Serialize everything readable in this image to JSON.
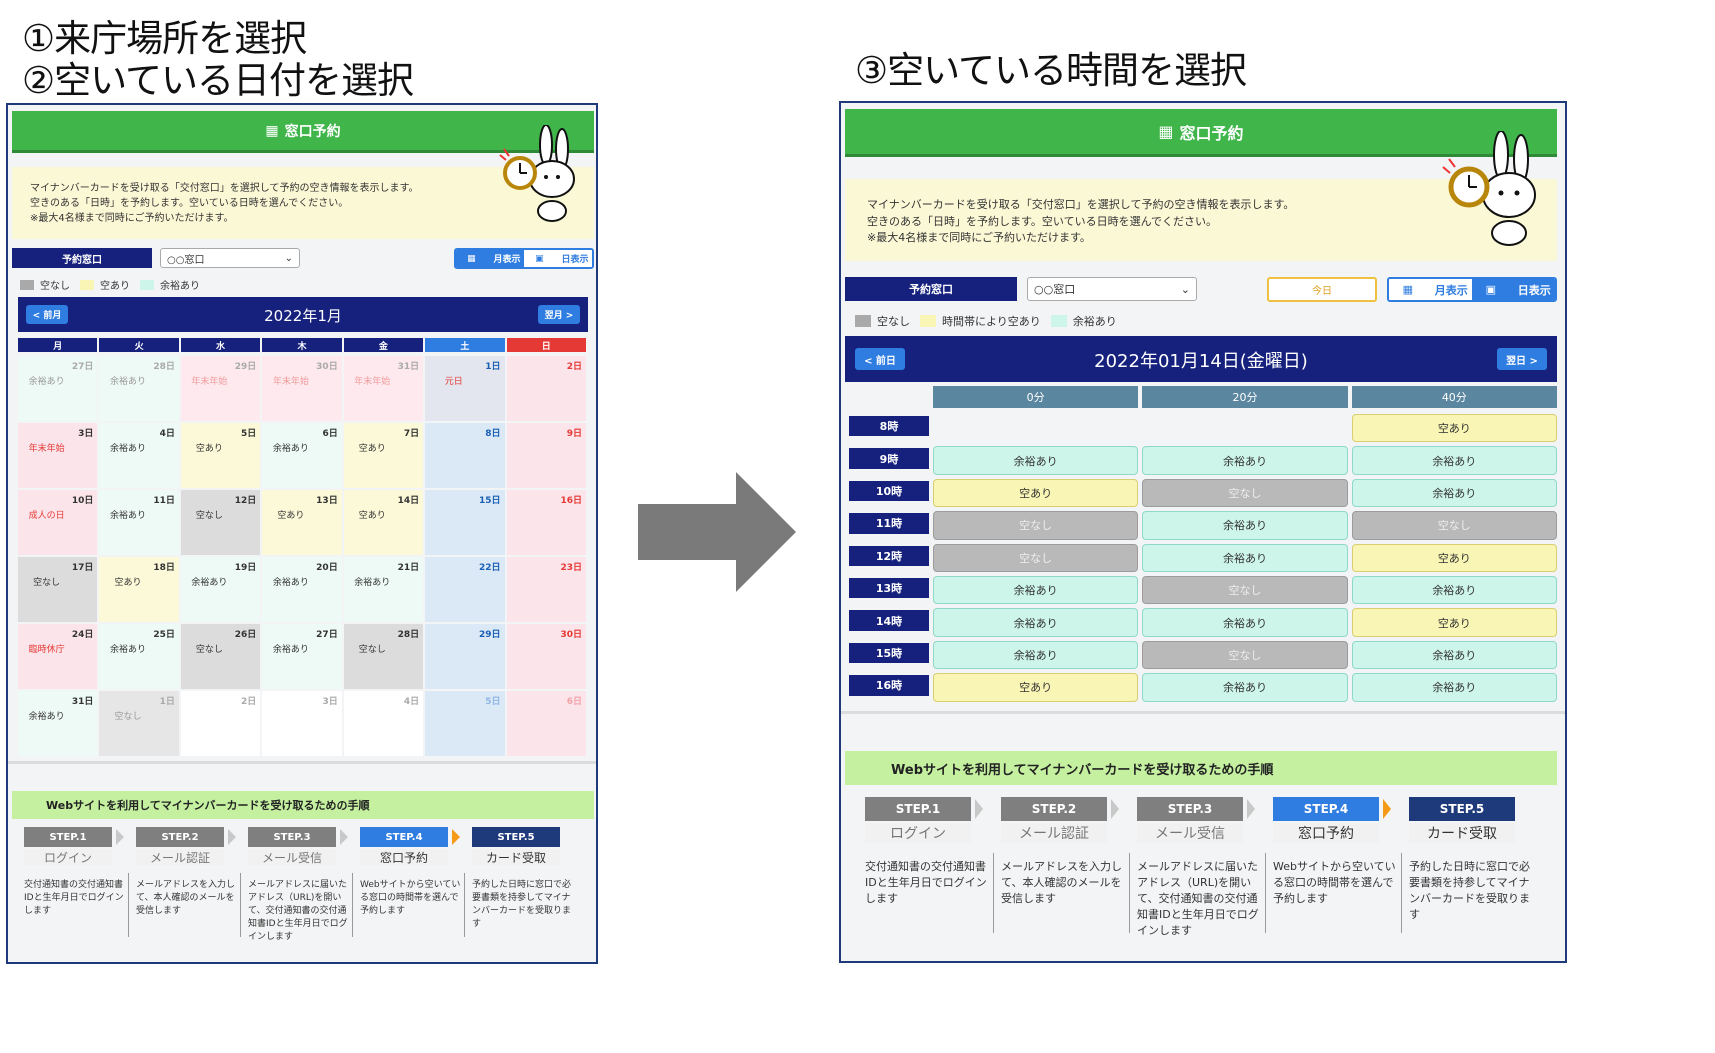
{
  "headings": {
    "step1": "①来庁場所を選択",
    "step2": "②空いている日付を選択",
    "step3": "③空いている時間を選択"
  },
  "header_title": "窓口予約",
  "info_lines": [
    "マイナンバーカードを受け取る「交付窓口」を選択して予約の空き情報を表示します。",
    "空きのある「日時」を予約します。空いている日時を選んでください。",
    "※最大4名様まで同時にご予約いただけます。"
  ],
  "counter_label": "予約窓口",
  "counter_value": "○○窓口",
  "view_month": "月表示",
  "view_day": "日表示",
  "today_label": "今日",
  "colors": {
    "green": "#3fb54a",
    "navy": "#15217d",
    "blue": "#2f7de0",
    "full": "#c9c9c9",
    "avail": "#f9f6b5",
    "ample": "#cdf5ea",
    "sat": "#dbe9f7",
    "sun": "#fbe4ea",
    "off": "#fbe4ea"
  },
  "calendar": {
    "legend": [
      "空なし",
      "空あり",
      "余裕あり"
    ],
    "prev": "< 前月",
    "next": "翌月 >",
    "title": "2022年1月",
    "weekdays": [
      "月",
      "火",
      "水",
      "木",
      "金",
      "土",
      "日"
    ],
    "weeks": [
      [
        {
          "d": "27日",
          "s": "余裕あり",
          "k": "out"
        },
        {
          "d": "28日",
          "s": "余裕あり",
          "k": "out"
        },
        {
          "d": "29日",
          "s": "年末年始",
          "k": "outoff"
        },
        {
          "d": "30日",
          "s": "年末年始",
          "k": "outoff"
        },
        {
          "d": "31日",
          "s": "年末年始",
          "k": "outoff"
        },
        {
          "d": "1日",
          "s": "元日",
          "k": "holsat"
        },
        {
          "d": "2日",
          "s": "",
          "k": "sun"
        }
      ],
      [
        {
          "d": "3日",
          "s": "年末年始",
          "k": "off"
        },
        {
          "d": "4日",
          "s": "余裕あり",
          "k": "ample"
        },
        {
          "d": "5日",
          "s": "空あり",
          "k": "avail"
        },
        {
          "d": "6日",
          "s": "余裕あり",
          "k": "ample"
        },
        {
          "d": "7日",
          "s": "空あり",
          "k": "avail"
        },
        {
          "d": "8日",
          "s": "",
          "k": "sat"
        },
        {
          "d": "9日",
          "s": "",
          "k": "sun"
        }
      ],
      [
        {
          "d": "10日",
          "s": "成人の日",
          "k": "off"
        },
        {
          "d": "11日",
          "s": "余裕あり",
          "k": "ample"
        },
        {
          "d": "12日",
          "s": "空なし",
          "k": "full"
        },
        {
          "d": "13日",
          "s": "空あり",
          "k": "avail"
        },
        {
          "d": "14日",
          "s": "空あり",
          "k": "avail"
        },
        {
          "d": "15日",
          "s": "",
          "k": "sat"
        },
        {
          "d": "16日",
          "s": "",
          "k": "sun"
        }
      ],
      [
        {
          "d": "17日",
          "s": "空なし",
          "k": "full"
        },
        {
          "d": "18日",
          "s": "空あり",
          "k": "avail"
        },
        {
          "d": "19日",
          "s": "余裕あり",
          "k": "ample"
        },
        {
          "d": "20日",
          "s": "余裕あり",
          "k": "ample"
        },
        {
          "d": "21日",
          "s": "余裕あり",
          "k": "ample"
        },
        {
          "d": "22日",
          "s": "",
          "k": "sat"
        },
        {
          "d": "23日",
          "s": "",
          "k": "sun"
        }
      ],
      [
        {
          "d": "24日",
          "s": "臨時休庁",
          "k": "off"
        },
        {
          "d": "25日",
          "s": "余裕あり",
          "k": "ample"
        },
        {
          "d": "26日",
          "s": "空なし",
          "k": "full"
        },
        {
          "d": "27日",
          "s": "余裕あり",
          "k": "ample"
        },
        {
          "d": "28日",
          "s": "空なし",
          "k": "full"
        },
        {
          "d": "29日",
          "s": "",
          "k": "sat"
        },
        {
          "d": "30日",
          "s": "",
          "k": "sun"
        }
      ],
      [
        {
          "d": "31日",
          "s": "余裕あり",
          "k": "ample"
        },
        {
          "d": "1日",
          "s": "空なし",
          "k": "outfull"
        },
        {
          "d": "2日",
          "s": "",
          "k": "blank"
        },
        {
          "d": "3日",
          "s": "",
          "k": "blank"
        },
        {
          "d": "4日",
          "s": "",
          "k": "blank"
        },
        {
          "d": "5日",
          "s": "",
          "k": "outsat"
        },
        {
          "d": "6日",
          "s": "",
          "k": "outsun"
        }
      ]
    ]
  },
  "timetable": {
    "legend": [
      "空なし",
      "時間帯により空あり",
      "余裕あり"
    ],
    "prev": "< 前日",
    "next": "翌日 >",
    "title": "2022年01月14日(金曜日)",
    "cols": [
      "0分",
      "20分",
      "40分"
    ],
    "rows": [
      {
        "h": "8時",
        "slots": [
          "",
          "",
          "空あり"
        ]
      },
      {
        "h": "9時",
        "slots": [
          "余裕あり",
          "余裕あり",
          "余裕あり"
        ]
      },
      {
        "h": "10時",
        "slots": [
          "空あり",
          "空なし",
          "余裕あり"
        ]
      },
      {
        "h": "11時",
        "slots": [
          "空なし",
          "余裕あり",
          "空なし"
        ]
      },
      {
        "h": "12時",
        "slots": [
          "空なし",
          "余裕あり",
          "空あり"
        ]
      },
      {
        "h": "13時",
        "slots": [
          "余裕あり",
          "空なし",
          "余裕あり"
        ]
      },
      {
        "h": "14時",
        "slots": [
          "余裕あり",
          "余裕あり",
          "空あり"
        ]
      },
      {
        "h": "15時",
        "slots": [
          "余裕あり",
          "空なし",
          "余裕あり"
        ]
      },
      {
        "h": "16時",
        "slots": [
          "空あり",
          "余裕あり",
          "余裕あり"
        ]
      }
    ]
  },
  "steps": {
    "title": "Webサイトを利用してマイナンバーカードを受け取るための手順",
    "items": [
      {
        "head": "STEP.1",
        "label": "ログイン",
        "desc": "交付通知書の交付通知書IDと生年月日でログインします",
        "state": "done"
      },
      {
        "head": "STEP.2",
        "label": "メール認証",
        "desc": "メールアドレスを入力して、本人確認のメールを受信します",
        "state": "done"
      },
      {
        "head": "STEP.3",
        "label": "メール受信",
        "desc": "メールアドレスに届いたアドレス（URL)を開いて、交付通知書の交付通知書IDと生年月日でログインします",
        "state": "done"
      },
      {
        "head": "STEP.4",
        "label": "窓口予約",
        "desc": "Webサイトから空いている窓口の時間帯を選んで予約します",
        "state": "current"
      },
      {
        "head": "STEP.5",
        "label": "カード受取",
        "desc": "予約した日時に窓口で必要書類を持参してマイナンバーカードを受取ります",
        "state": "next"
      }
    ]
  }
}
